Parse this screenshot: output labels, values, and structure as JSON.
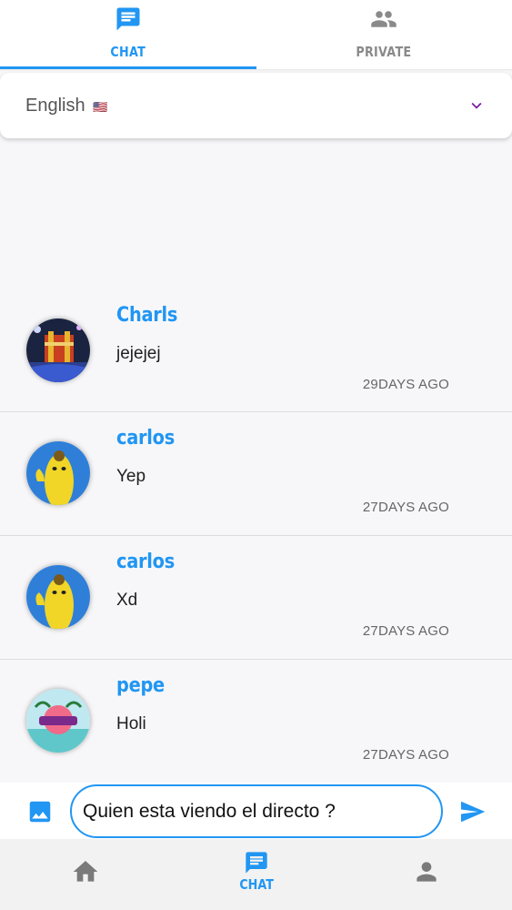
{
  "top_tabs": [
    {
      "label": "CHAT",
      "icon": "chat-bubble-icon",
      "active": true
    },
    {
      "label": "PRIVATE",
      "icon": "people-icon",
      "active": false
    }
  ],
  "language": {
    "label": "English",
    "flag": "🇺🇸"
  },
  "messages": [
    {
      "author": "Charls",
      "text": "jejejej",
      "time": "29DAYS AGO",
      "avatar": "concert-stage"
    },
    {
      "author": "carlos",
      "text": "Yep",
      "time": "27DAYS AGO",
      "avatar": "banana-character"
    },
    {
      "author": "carlos",
      "text": "Xd",
      "time": "27DAYS AGO",
      "avatar": "banana-character"
    },
    {
      "author": "pepe",
      "text": "Holi",
      "time": "27DAYS AGO",
      "avatar": "beach-logo"
    }
  ],
  "composer": {
    "value": "Quien esta viendo el directo ?",
    "image_icon": "image-icon",
    "send_icon": "send-icon"
  },
  "bottom_nav": {
    "home_icon": "home-icon",
    "chat_label": "CHAT",
    "profile_icon": "person-icon"
  },
  "colors": {
    "accent": "#2196f3",
    "purple_chevron": "#7b1fa2",
    "inactive": "#8a8a8a"
  }
}
